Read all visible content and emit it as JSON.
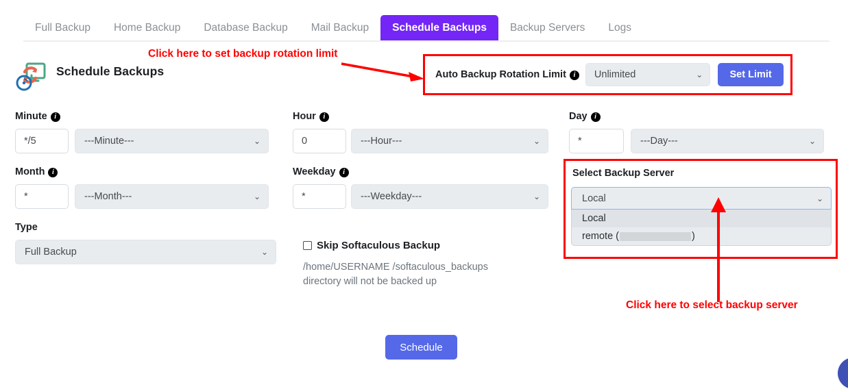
{
  "tabs": [
    {
      "label": "Full Backup",
      "active": false
    },
    {
      "label": "Home Backup",
      "active": false
    },
    {
      "label": "Database Backup",
      "active": false
    },
    {
      "label": "Mail Backup",
      "active": false
    },
    {
      "label": "Schedule Backups",
      "active": true
    },
    {
      "label": "Backup Servers",
      "active": false
    },
    {
      "label": "Logs",
      "active": false
    }
  ],
  "header": {
    "title": "Schedule Backups",
    "logo_icon": "backup-restore-icon"
  },
  "rotation": {
    "label": "Auto Backup Rotation Limit",
    "info_icon": "info-icon",
    "selected": "Unlimited",
    "chevron": "⌄",
    "button_label": "Set Limit"
  },
  "cron": {
    "minute": {
      "label": "Minute",
      "value": "*/5",
      "select": "---Minute---"
    },
    "hour": {
      "label": "Hour",
      "value": "0",
      "select": "---Hour---"
    },
    "day": {
      "label": "Day",
      "value": "*",
      "select": "---Day---"
    },
    "month": {
      "label": "Month",
      "value": "*",
      "select": "---Month---"
    },
    "weekday": {
      "label": "Weekday",
      "value": "*",
      "select": "---Weekday---"
    }
  },
  "type": {
    "label": "Type",
    "selected": "Full Backup"
  },
  "skip": {
    "label": "Skip Softaculous Backup",
    "note": "/home/USERNAME /softaculous_backups directory will not be backed up",
    "checked": false
  },
  "server": {
    "title": "Select Backup Server",
    "selected": "Local",
    "options": [
      {
        "label": "Local",
        "highlighted": true,
        "redacted": false
      },
      {
        "label": "remote (",
        "label_suffix": ")",
        "highlighted": false,
        "redacted": true
      }
    ]
  },
  "annotations": {
    "rotation_hint": "Click here to set backup rotation limit",
    "server_hint": "Click here to select backup server"
  },
  "submit": {
    "label": "Schedule"
  },
  "colors": {
    "accent_purple": "#7326f5",
    "button_blue": "#5468e8",
    "annotation_red": "#ff0000",
    "field_grey": "#e9ecef"
  }
}
